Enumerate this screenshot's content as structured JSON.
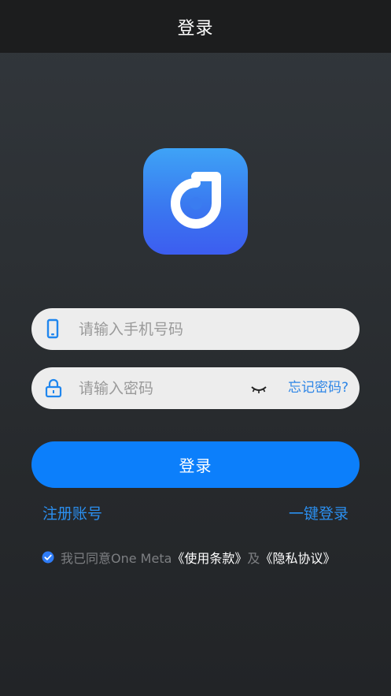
{
  "nav": {
    "title": "登录"
  },
  "icons": {
    "app_logo": "app-logo-icon",
    "phone": "phone-icon",
    "lock": "lock-icon",
    "eye": "eye-closed-icon",
    "check": "checkbox-checked-icon"
  },
  "form": {
    "phone_placeholder": "请输入手机号码",
    "phone_value": "",
    "password_placeholder": "请输入密码",
    "password_value": "",
    "forgot_label": "忘记密码?"
  },
  "login_button_label": "登录",
  "links": {
    "register": "注册账号",
    "quick_login": "一键登录"
  },
  "agreement": {
    "checked": true,
    "prefix": "我已同意One Meta",
    "terms": "《使用条款》",
    "and": "及",
    "privacy": "《隐私协议》"
  },
  "colors": {
    "accent": "#0c7ffb",
    "link": "#2b8ff0",
    "nav_bg": "#1c1d1e",
    "logo_top": "#3ea3f6",
    "logo_bottom": "#3c5df0"
  }
}
